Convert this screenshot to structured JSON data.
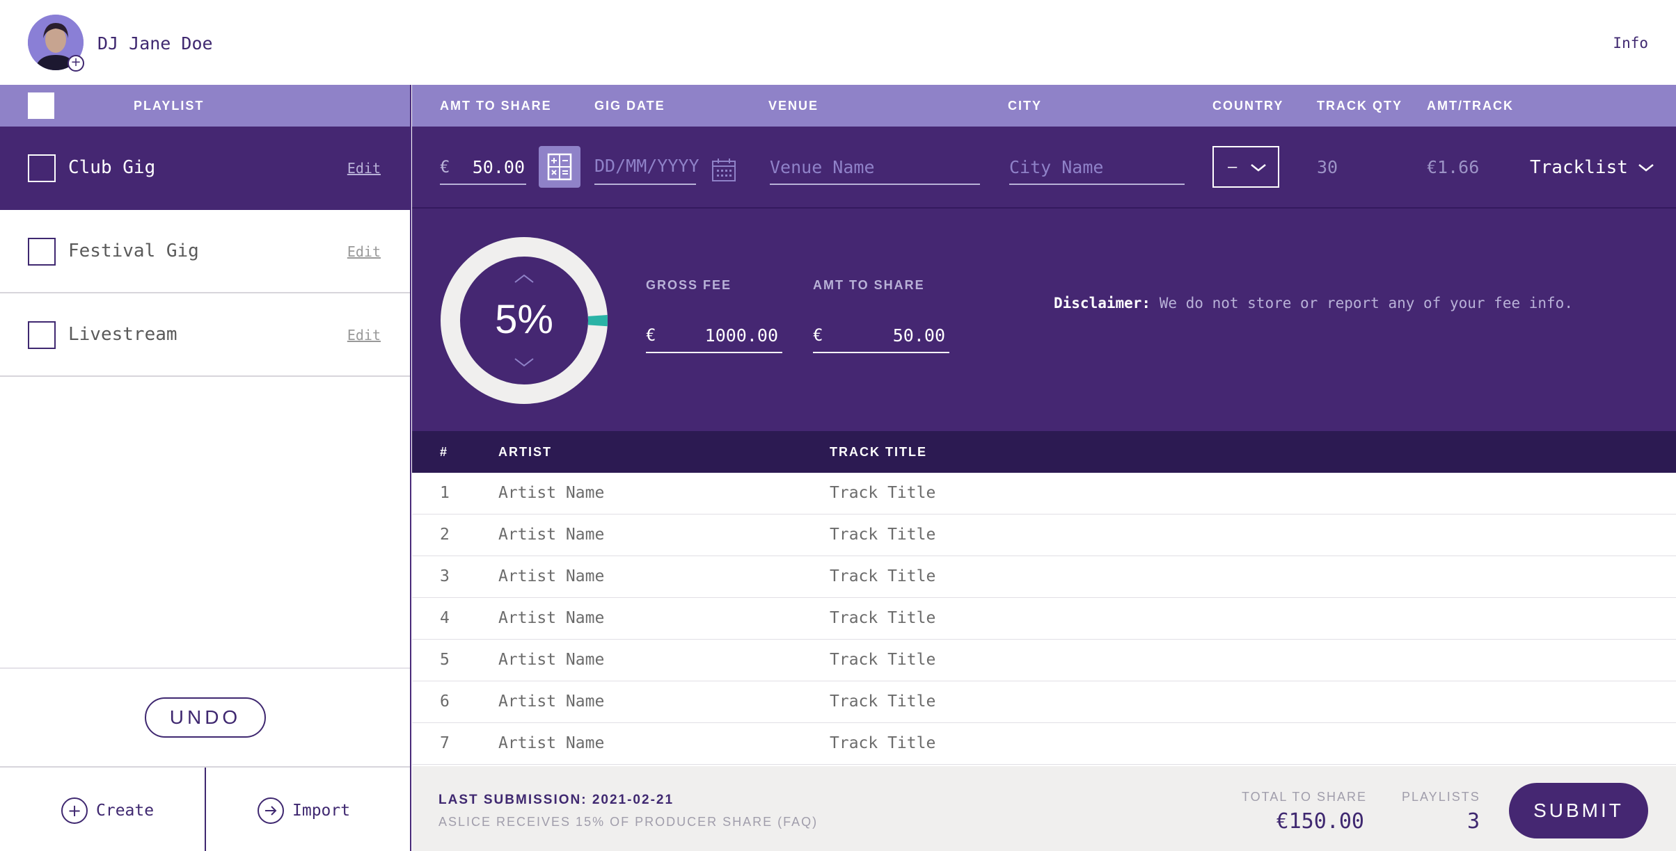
{
  "user": {
    "name": "DJ Jane Doe"
  },
  "header": {
    "info_label": "Info"
  },
  "sidebar": {
    "header_label": "PLAYLIST",
    "playlists": [
      {
        "name": "Club Gig",
        "edit_label": "Edit",
        "active": true
      },
      {
        "name": "Festival Gig",
        "edit_label": "Edit",
        "active": false
      },
      {
        "name": "Livestream",
        "edit_label": "Edit",
        "active": false
      }
    ],
    "undo_label": "UNDO",
    "create_label": "Create",
    "import_label": "Import"
  },
  "columns": {
    "amt_to_share": "AMT TO SHARE",
    "gig_date": "GIG DATE",
    "venue": "VENUE",
    "city": "CITY",
    "country": "COUNTRY",
    "track_qty": "TRACK QTY",
    "amt_track": "AMT/TRACK"
  },
  "gig": {
    "currency": "€",
    "amount": "50.00",
    "date_placeholder": "DD/MM/YYYY",
    "venue_placeholder": "Venue Name",
    "city_placeholder": "City Name",
    "country_value": "–",
    "track_qty": "30",
    "amt_per_track": "€1.66",
    "tracklist_label": "Tracklist"
  },
  "fee_panel": {
    "percent_label": "5%",
    "percent_value": 5,
    "gross_fee_label": "GROSS FEE",
    "gross_fee_currency": "€",
    "gross_fee_value": "1000.00",
    "amt_to_share_label": "AMT TO SHARE",
    "amt_to_share_currency": "€",
    "amt_to_share_value": "50.00",
    "disclaimer_label": "Disclaimer:",
    "disclaimer_text": "We do not store or report any of your fee info."
  },
  "tracks": {
    "headers": {
      "number": "#",
      "artist": "ARTIST",
      "title": "TRACK TITLE"
    },
    "rows": [
      {
        "number": "1",
        "artist": "Artist Name",
        "title": "Track Title"
      },
      {
        "number": "2",
        "artist": "Artist Name",
        "title": "Track Title"
      },
      {
        "number": "3",
        "artist": "Artist Name",
        "title": "Track Title"
      },
      {
        "number": "4",
        "artist": "Artist Name",
        "title": "Track Title"
      },
      {
        "number": "5",
        "artist": "Artist Name",
        "title": "Track Title"
      },
      {
        "number": "6",
        "artist": "Artist Name",
        "title": "Track Title"
      },
      {
        "number": "7",
        "artist": "Artist Name",
        "title": "Track Title"
      }
    ]
  },
  "footer": {
    "last_submission": "LAST SUBMISSION: 2021-02-21",
    "aslice_note": "ASLICE RECEIVES 15% OF PRODUCER SHARE (FAQ)",
    "total_label": "TOTAL TO SHARE",
    "total_value": "€150.00",
    "playlists_label": "PLAYLISTS",
    "playlists_value": "3",
    "submit_label": "SUBMIT"
  },
  "colors": {
    "brand_dark": "#452772",
    "brand_light": "#8f82c8",
    "accent_teal": "#2ab3a6"
  }
}
